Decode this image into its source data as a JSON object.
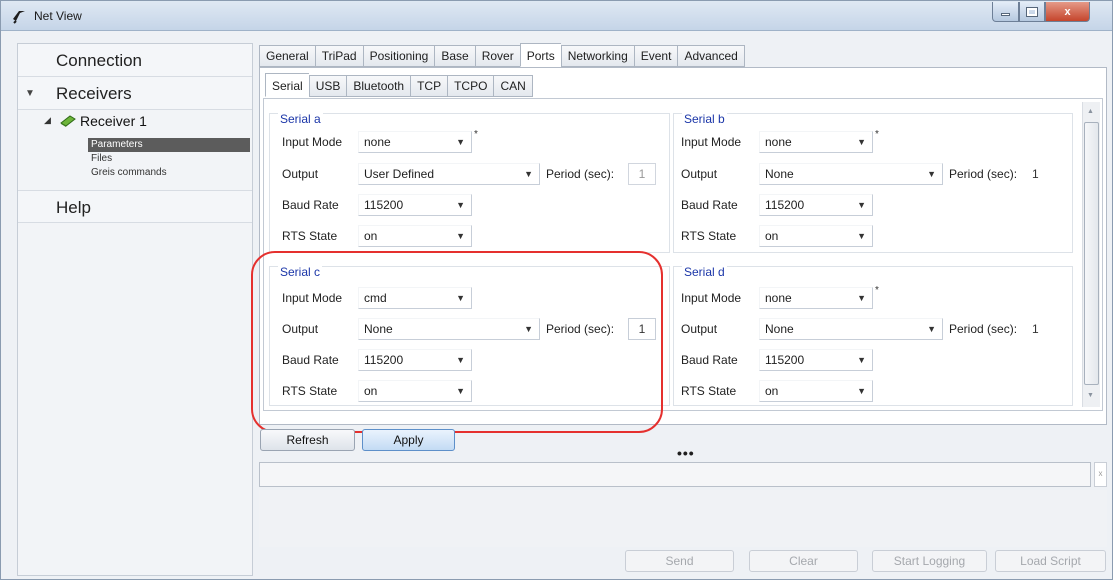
{
  "window": {
    "title": "Net View",
    "controls": [
      "minimize",
      "maximize",
      "close"
    ],
    "close_label": "x"
  },
  "sidebar": {
    "connection_label": "Connection",
    "receivers_label": "Receivers",
    "receiver_name": "Receiver 1",
    "sub_items": [
      "Parameters",
      "Files",
      "Greis commands"
    ],
    "selected_sub_item": "Parameters",
    "help_label": "Help"
  },
  "tabs": [
    "General",
    "TriPad",
    "Positioning",
    "Base",
    "Rover",
    "Ports",
    "Networking",
    "Event",
    "Advanced"
  ],
  "active_tab": "Ports",
  "subtabs": [
    "Serial",
    "USB",
    "Bluetooth",
    "TCP",
    "TCPO",
    "CAN"
  ],
  "active_subtab": "Serial",
  "labels": {
    "input_mode": "Input Mode",
    "output": "Output",
    "baud_rate": "Baud Rate",
    "rts_state": "RTS State",
    "period": "Period (sec):"
  },
  "serial": {
    "a": {
      "title": "Serial a",
      "input_mode": "none",
      "output": "User Defined",
      "period": "1",
      "baud_rate": "115200",
      "rts_state": "on"
    },
    "b": {
      "title": "Serial b",
      "input_mode": "none",
      "output": "None",
      "period": "1",
      "baud_rate": "115200",
      "rts_state": "on"
    },
    "c": {
      "title": "Serial c",
      "input_mode": "cmd",
      "output": "None",
      "period": "1",
      "baud_rate": "115200",
      "rts_state": "on"
    },
    "d": {
      "title": "Serial d",
      "input_mode": "none",
      "output": "None",
      "period": "1",
      "baud_rate": "115200",
      "rts_state": "on"
    }
  },
  "buttons": {
    "refresh": "Refresh",
    "apply": "Apply",
    "send": "Send",
    "clear": "Clear",
    "start_logging": "Start Logging",
    "load_script": "Load Script"
  },
  "splitter_dots": "•••",
  "colors": {
    "group_title": "#1b36a8",
    "highlight": "#e5302e",
    "selected_item": "#5c5c5c"
  }
}
